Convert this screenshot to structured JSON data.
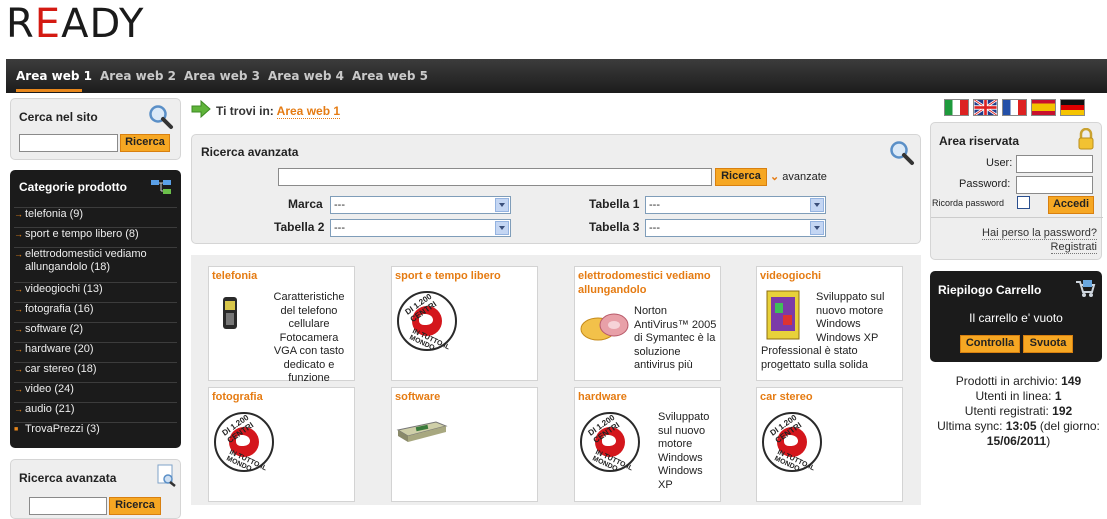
{
  "logo": {
    "text_r": "R",
    "text_e": "E",
    "text_rest": "ADY"
  },
  "nav": {
    "items": [
      "Area web 1",
      "Area web 2",
      "Area web 3",
      "Area web 4",
      "Area web 5"
    ],
    "active": 0
  },
  "search_site": {
    "title": "Cerca nel sito",
    "button": "Ricerca",
    "icon": "magnifier-icon"
  },
  "categories": {
    "title": "Categorie prodotto",
    "items": [
      "telefonia (9)",
      "sport e tempo libero (8)",
      "elettrodomestici vediamo allungandolo (18)",
      "videogiochi (13)",
      "fotografia (16)",
      "software (2)",
      "hardware (20)",
      "car stereo (18)",
      "video (24)",
      "audio (21)",
      "TrovaPrezzi (3)"
    ]
  },
  "adv_search_side": {
    "title": "Ricerca avanzata",
    "button": "Ricerca"
  },
  "breadcrumb": {
    "label": "Ti trovi in:",
    "link": "Area web 1"
  },
  "adv_search": {
    "title": "Ricerca avanzata",
    "button": "Ricerca",
    "advanced_link": "avanzate",
    "fields": [
      {
        "label": "Marca",
        "value": "---"
      },
      {
        "label": "Tabella 1",
        "value": "---"
      },
      {
        "label": "Tabella 2",
        "value": "---"
      },
      {
        "label": "Tabella 3",
        "value": "---"
      }
    ]
  },
  "products": [
    {
      "title": "telefonia",
      "desc": "Caratteristiche del telefono cellulare Fotocamera VGA con tasto dedicato e funzione autoscatto",
      "img": "phone-product-icon"
    },
    {
      "title": "sport e tempo libero",
      "desc": "",
      "img": "centri-stamp-icon"
    },
    {
      "title": "elettrodomestici vediamo allungandolo",
      "desc": "Norton AntiVirus™ 2005 di Symantec è la soluzione antivirus più",
      "img": "antivirus-box-icon"
    },
    {
      "title": "videogiochi",
      "desc": "Sviluppato sul nuovo motore Windows Windows XP Professional è stato progettato sulla solida",
      "img": "game-box-icon"
    },
    {
      "title": "fotografia",
      "desc": "",
      "img": "centri-stamp-icon"
    },
    {
      "title": "software",
      "desc": "",
      "img": "software-box-icon"
    },
    {
      "title": "hardware",
      "desc": "Sviluppato sul nuovo motore Windows Windows XP",
      "img": "centri-stamp-icon"
    },
    {
      "title": "car stereo",
      "desc": "",
      "img": "centri-stamp-icon"
    }
  ],
  "stamp": {
    "top": "DI 1.200 CENTRI",
    "bottom": "IN TUTTO IL MONDO"
  },
  "flags": [
    "italy-flag-icon",
    "uk-flag-icon",
    "france-flag-icon",
    "spain-flag-icon",
    "germany-flag-icon"
  ],
  "login": {
    "title": "Area riservata",
    "user_label": "User:",
    "password_label": "Password:",
    "remember_label": "Ricorda password",
    "button": "Accedi",
    "forgot_link": "Hai perso la password?",
    "register_link": "Registrati"
  },
  "cart": {
    "title": "Riepilogo Carrello",
    "empty_text": "Il carrello e' vuoto",
    "check_button": "Controlla",
    "empty_button": "Svuota"
  },
  "stats": {
    "products_label": "Prodotti in archivio:",
    "products": "149",
    "online_label": "Utenti in linea:",
    "online": "1",
    "registered_label": "Utenti registrati:",
    "registered": "192",
    "sync_label": "Ultima sync:",
    "sync_time": "13:05",
    "sync_mid": "(del giorno:",
    "sync_date": "15/06/2011",
    "sync_end": ")"
  }
}
